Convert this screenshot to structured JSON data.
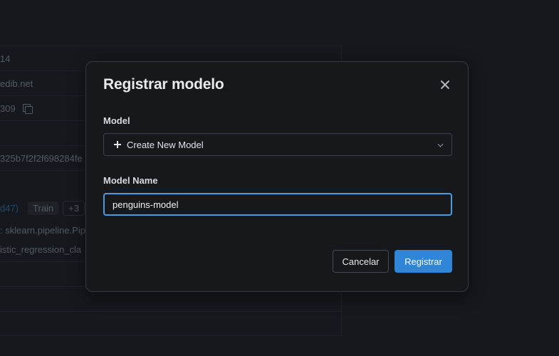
{
  "background": {
    "rows": [
      {
        "text": "14"
      },
      {
        "text": "edib.net"
      },
      {
        "text": "309"
      },
      {
        "text": ""
      },
      {
        "text": "325b7f2f2f698284fe"
      },
      {
        "text": ""
      },
      {
        "text": ""
      },
      {
        "text": ": sklearn.pipeline.Pip"
      },
      {
        "text": "istic_regression_cla"
      }
    ],
    "tags": [
      "d47)",
      "Train",
      "+3"
    ]
  },
  "modal": {
    "title": "Registrar modelo",
    "model_label": "Model",
    "model_select_value": "Create New Model",
    "name_label": "Model Name",
    "name_value": "penguins-model",
    "cancel_label": "Cancelar",
    "submit_label": "Registrar"
  },
  "colors": {
    "accent": "#2f86d8",
    "focus_ring": "#4a9be0",
    "modal_bg": "#16181c",
    "page_bg": "#1c1f24"
  },
  "icons": {
    "close": "close-icon",
    "plus": "plus-icon",
    "chevron": "chevron-down-icon",
    "copy": "copy-icon"
  }
}
